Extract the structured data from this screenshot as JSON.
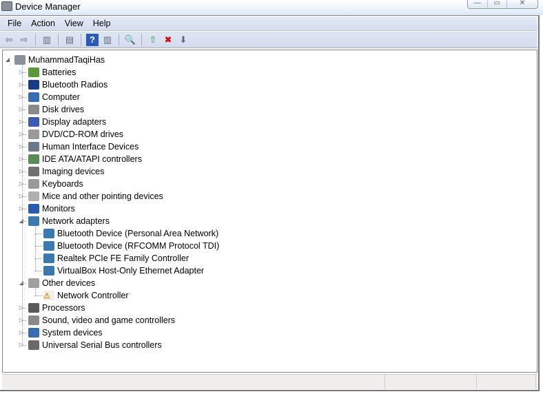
{
  "window": {
    "title": "Device Manager",
    "min": "—",
    "max": "▭",
    "close": "✕"
  },
  "menu": [
    "File",
    "Action",
    "View",
    "Help"
  ],
  "toolbar": [
    {
      "name": "back-icon",
      "glyph": "⇦"
    },
    {
      "name": "forward-icon",
      "glyph": "⇨"
    },
    {
      "sep": true
    },
    {
      "name": "show-hide-console-tree-icon",
      "glyph": "▥"
    },
    {
      "sep": true
    },
    {
      "name": "properties-icon",
      "glyph": "▤"
    },
    {
      "sep": true
    },
    {
      "name": "help-icon",
      "glyph": "?"
    },
    {
      "name": "show-action-pane-icon",
      "glyph": "▥"
    },
    {
      "sep": true
    },
    {
      "name": "scan-hardware-icon",
      "glyph": "🔍"
    },
    {
      "sep": true
    },
    {
      "name": "update-driver-icon",
      "glyph": "⇧"
    },
    {
      "name": "uninstall-icon",
      "glyph": "✖"
    },
    {
      "name": "disable-icon",
      "glyph": "⬇"
    }
  ],
  "tree": {
    "root": "MuhammadTaqiHas",
    "categories": [
      {
        "label": "Batteries",
        "color": "#5a9a3a",
        "expanded": false,
        "selected_expander": true
      },
      {
        "label": "Bluetooth Radios",
        "color": "#1a3a8a",
        "expanded": false
      },
      {
        "label": "Computer",
        "color": "#3a6ab0",
        "expanded": false
      },
      {
        "label": "Disk drives",
        "color": "#8a8a8a",
        "expanded": false
      },
      {
        "label": "Display adapters",
        "color": "#3a5ab0",
        "expanded": false
      },
      {
        "label": "DVD/CD-ROM drives",
        "color": "#9a9a9a",
        "expanded": false
      },
      {
        "label": "Human Interface Devices",
        "color": "#6a7a8a",
        "expanded": false
      },
      {
        "label": "IDE ATA/ATAPI controllers",
        "color": "#5a8a5a",
        "expanded": false
      },
      {
        "label": "Imaging devices",
        "color": "#707070",
        "expanded": false
      },
      {
        "label": "Keyboards",
        "color": "#9a9a9a",
        "expanded": false
      },
      {
        "label": "Mice and other pointing devices",
        "color": "#b0b0b0",
        "expanded": false
      },
      {
        "label": "Monitors",
        "color": "#2a5ab0",
        "expanded": false
      },
      {
        "label": "Network adapters",
        "color": "#3a7ab0",
        "expanded": true,
        "children": [
          {
            "label": "Bluetooth Device (Personal Area Network)",
            "color": "#3a7ab0"
          },
          {
            "label": "Bluetooth Device (RFCOMM Protocol TDI)",
            "color": "#3a7ab0"
          },
          {
            "label": "Realtek PCIe FE Family Controller",
            "color": "#3a7ab0"
          },
          {
            "label": "VirtualBox Host-Only Ethernet Adapter",
            "color": "#3a7ab0"
          }
        ]
      },
      {
        "label": "Other devices",
        "color": "#a0a0a0",
        "expanded": true,
        "children": [
          {
            "label": "Network Controller",
            "color": "#e0c020",
            "warning": true
          }
        ]
      },
      {
        "label": "Processors",
        "color": "#5a5a5a",
        "expanded": false
      },
      {
        "label": "Sound, video and game controllers",
        "color": "#8a8a8a",
        "expanded": false
      },
      {
        "label": "System devices",
        "color": "#3a6ab0",
        "expanded": false
      },
      {
        "label": "Universal Serial Bus controllers",
        "color": "#6a6a6a",
        "expanded": false
      }
    ]
  }
}
